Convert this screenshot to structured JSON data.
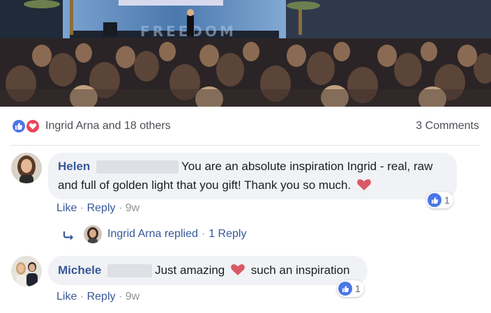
{
  "photo": {
    "stage_banner_text": "FREEDOM"
  },
  "reactions": {
    "summary": "Ingrid Arna and 18 others",
    "comments_count": "3 Comments",
    "like_color": "#4a76e8",
    "love_color": "#e9465a"
  },
  "comments": [
    {
      "author": "Helen",
      "text": "You are an absolute inspiration Ingrid - real, raw and full of golden light that you gift! Thank you so much.",
      "emoji": "heart",
      "like_count": "1",
      "like_label": "Like",
      "reply_label": "Reply",
      "time": "9w",
      "reply_summary": {
        "replier": "Ingrid Arna replied",
        "count": "1 Reply"
      }
    },
    {
      "author": "Michele",
      "text_before": "Just amazing",
      "emoji": "heart",
      "text_after": "such an inspiration",
      "like_count": "1",
      "like_label": "Like",
      "reply_label": "Reply",
      "time": "9w"
    }
  ],
  "separator": "·"
}
